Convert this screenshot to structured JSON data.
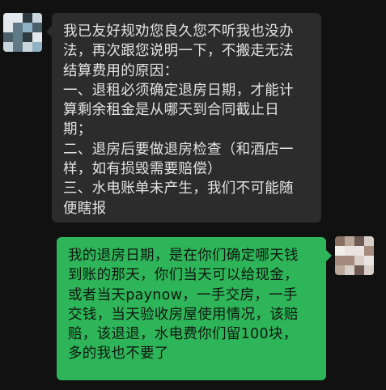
{
  "messages": [
    {
      "sender": "other",
      "lines": [
        "我已友好规劝您良久您不听我也没办",
        "法，再次跟您说明一下，不搬走无法",
        "结算费用的原因：",
        "一、退租必须确定退房日期，才能计",
        "算剩余租金是从哪天到合同截止日",
        "期；",
        "二、退房后要做退房检查（和酒店一",
        "样，如有损毁需要赔偿）",
        "三、水电账单未产生，我们不可能随",
        "便瞎报"
      ]
    },
    {
      "sender": "self",
      "lines": [
        "我的退房日期，是在你们确定哪天钱",
        "到账的那天，你们当天可以给现金，",
        "或者当天paynow，一手交房，一手",
        "交钱，当天验收房屋使用情况，该赔",
        "赔，该退退，水电费你们留100块，",
        "多的我也不要了"
      ]
    }
  ],
  "colors": {
    "background": "#111111",
    "incoming_bubble": "#2c2c2c",
    "incoming_text": "#e3e3e3",
    "outgoing_bubble": "#2fb559",
    "outgoing_text": "#0e170f"
  },
  "avatars": {
    "left": {
      "icon": "blurred-avatar-icon",
      "palette": [
        "#2d3a40",
        "#5f7a86",
        "#8fb3c4",
        "#c9d6dc",
        "#4b5f6a",
        "#a7c2cf",
        "#3a4a52",
        "#e2e8eb"
      ]
    },
    "right": {
      "icon": "blurred-avatar-icon",
      "palette": [
        "#b9a79a",
        "#d8cfc8",
        "#8a6f63",
        "#e9e4df",
        "#a58b7e",
        "#6d5a52",
        "#cfc2b8",
        "#f1eeea"
      ]
    }
  }
}
